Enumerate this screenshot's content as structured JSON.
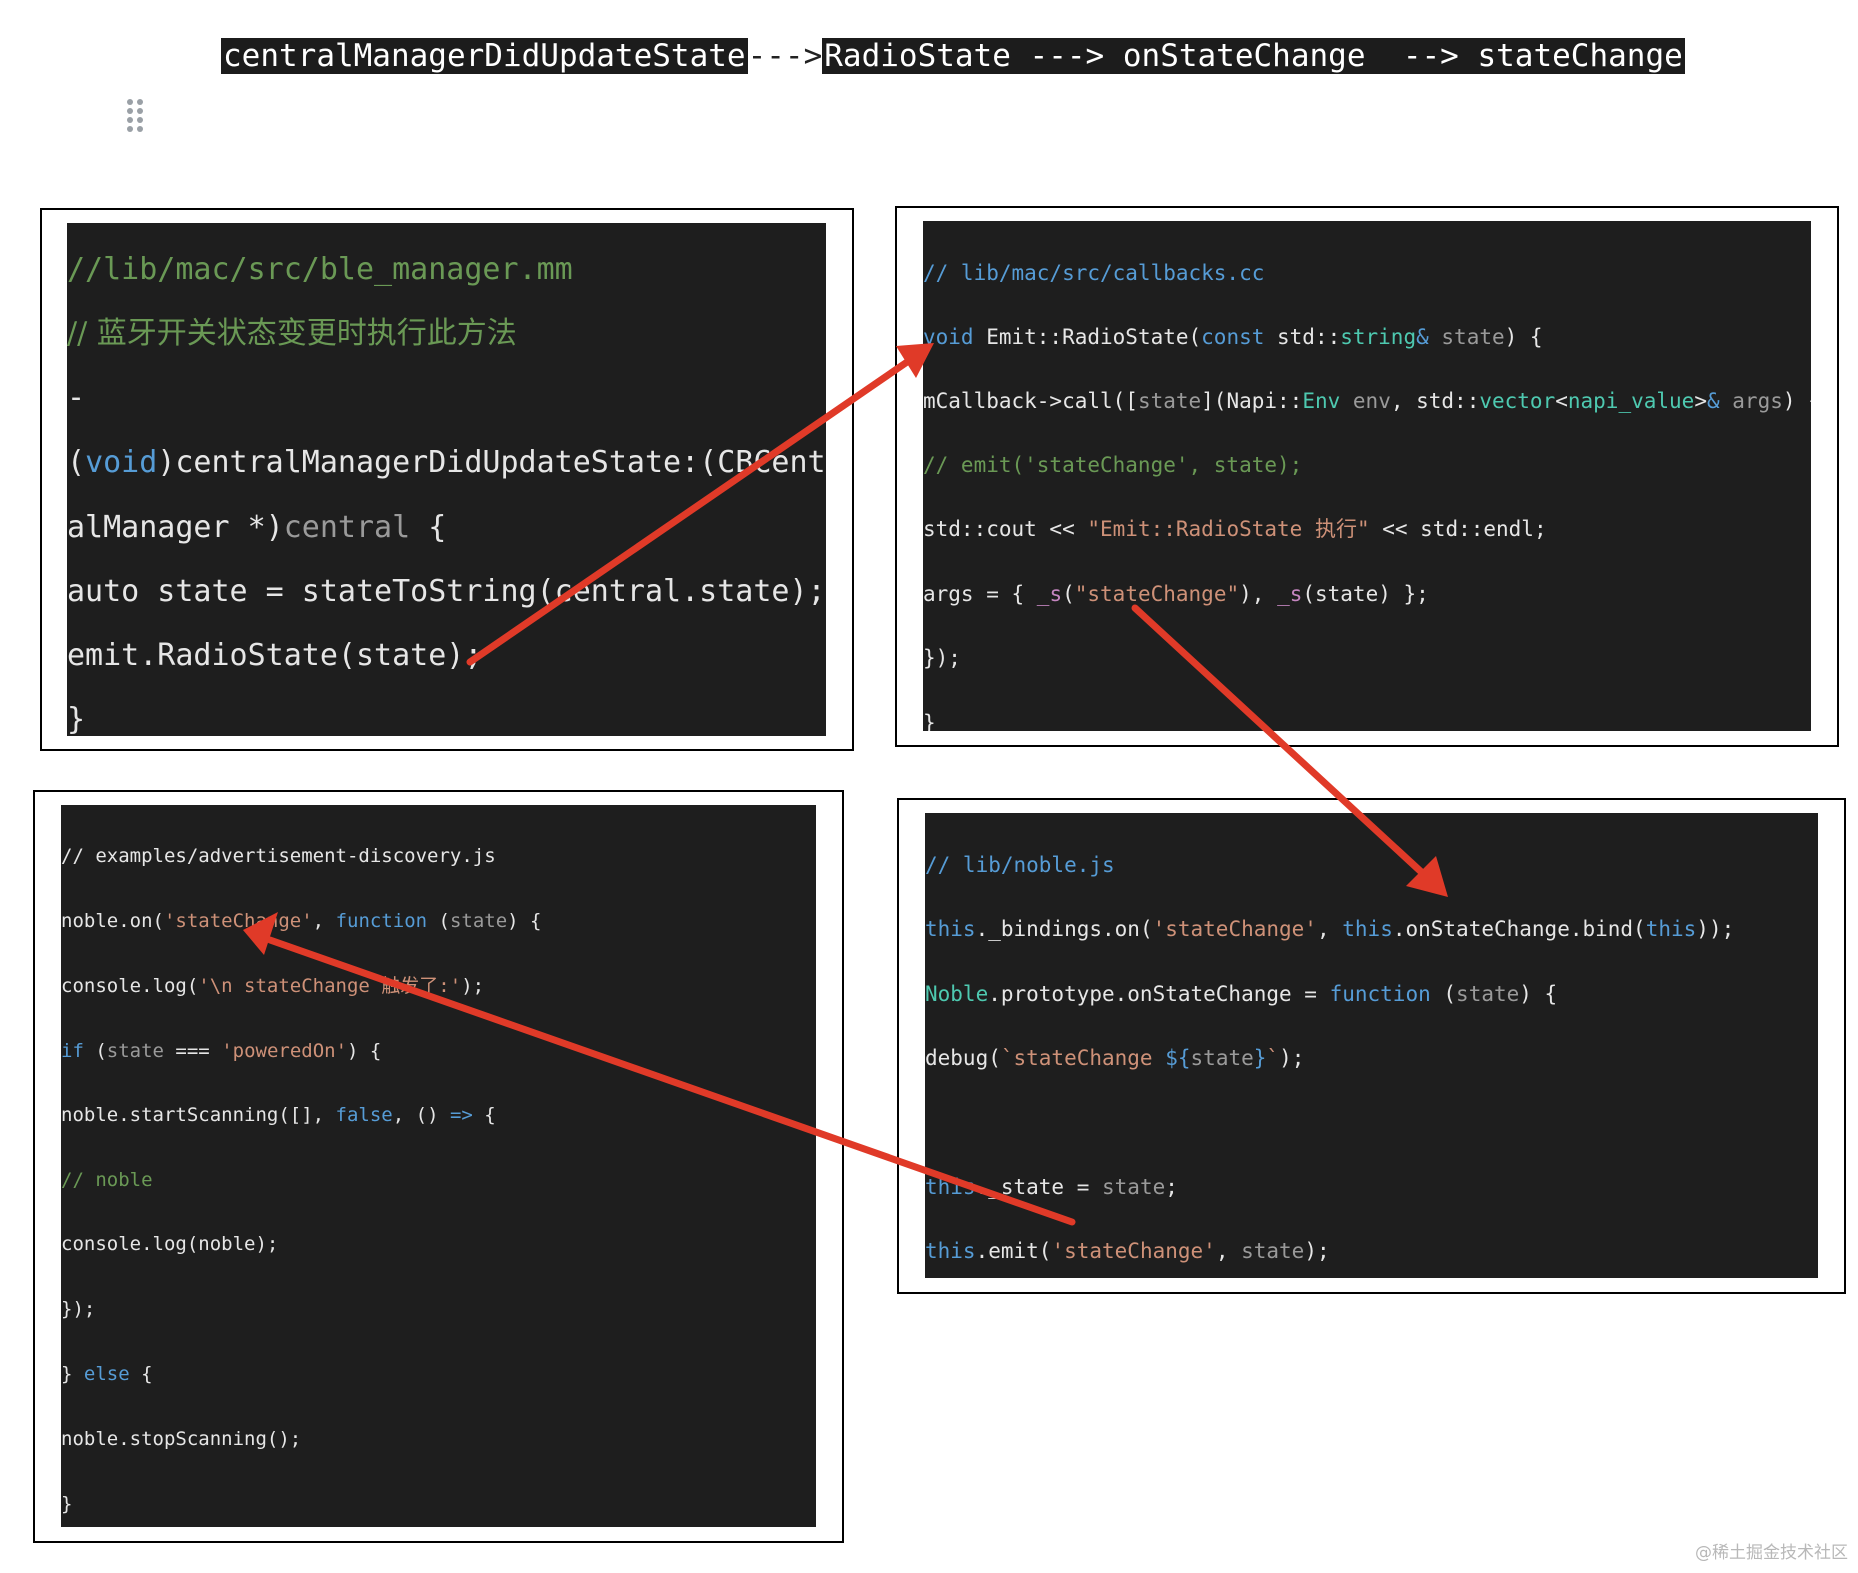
{
  "header": {
    "step1": "centralManagerDidUpdateState",
    "sep1": "--->",
    "step2": "RadioState ---> onStateChange  --> stateChange"
  },
  "panels": {
    "ble_manager": {
      "lines": [
        "//lib/mac/src/ble_manager.mm",
        "// 蓝牙开关状态变更时执行此方法",
        "-",
        "(void)centralManagerDidUpdateState:(CBCentr",
        "alManager *)central {",
        "auto state = stateToString(central.state);",
        "emit.RadioState(state);",
        "}"
      ]
    },
    "callbacks": {
      "lines": [
        "// lib/mac/src/callbacks.cc",
        "void Emit::RadioState(const std::string& state) {",
        "mCallback->call([state](Napi::Env env, std::vector<napi_value>& args) {",
        "// emit('stateChange', state);",
        "std::cout << \"Emit::RadioState 执行\" << std::endl;",
        "args = { _s(\"stateChange\"), _s(state) };",
        "});",
        "}"
      ]
    },
    "advertisement": {
      "lines": [
        "// examples/advertisement-discovery.js",
        "noble.on('stateChange', function (state) {",
        "console.log('\\n stateChange 触发了:');",
        "if (state === 'poweredOn') {",
        "noble.startScanning([], false, () => {",
        "// noble",
        "console.log(noble);",
        "});",
        "} else {",
        "noble.stopScanning();",
        "}"
      ]
    },
    "noble": {
      "lines": [
        "// lib/noble.js",
        "this._bindings.on('stateChange', this.onStateChange.bind(this));",
        "Noble.prototype.onStateChange = function (state) {",
        "debug(`stateChange ${state}`);",
        "this._state = state;",
        "this.emit('stateChange', state);"
      ]
    }
  },
  "watermark": "@稀土掘金技术社区",
  "colors": {
    "arrow": "#e03a28",
    "code_bg": "#1e1e1e",
    "comment": "#6a9955",
    "keyword": "#569cd6",
    "string": "#ce9178",
    "type": "#4ec9b0"
  }
}
